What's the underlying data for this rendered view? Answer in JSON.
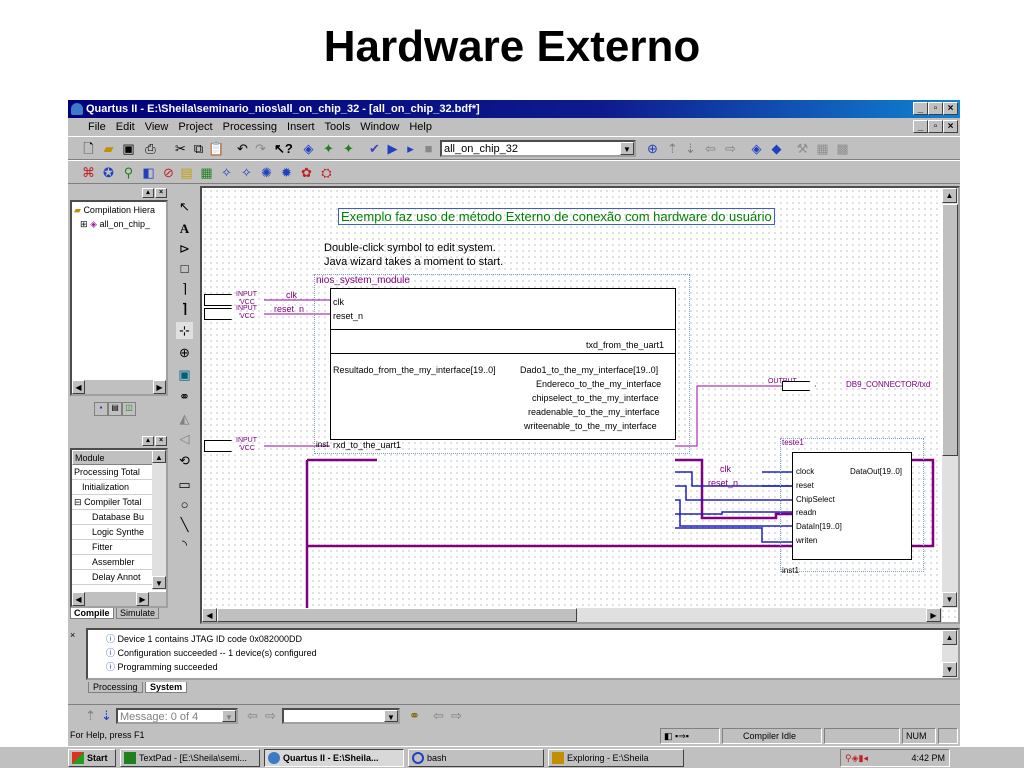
{
  "slide_title": "Hardware Externo",
  "window": {
    "title": "Quartus II - E:\\Sheila\\seminario_nios\\all_on_chip_32 - [all_on_chip_32.bdf*]",
    "menu": [
      "File",
      "Edit",
      "View",
      "Project",
      "Processing",
      "Insert",
      "Tools",
      "Window",
      "Help"
    ],
    "project_combo": "all_on_chip_32"
  },
  "project_nav": {
    "tree_root": "Compilation Hiera",
    "tree_child": "all_on_chip_",
    "tabs": [
      "Compile",
      "Simulate"
    ],
    "module_header": "Module",
    "modules": [
      "Processing Total",
      "Initialization",
      "Compiler Total",
      "Database Bu",
      "Logic Synthe",
      "Fitter",
      "Assembler",
      "Delay Annot"
    ]
  },
  "schematic": {
    "annotation": "Exemplo faz uso de método Externo de conexão com hardware do usuário",
    "hint_line1": "Double-click symbol to edit system.",
    "hint_line2": "Java wizard takes a moment to start.",
    "nios": {
      "name": "nios_system_module",
      "inst": "inst",
      "ports_left": [
        "clk",
        "reset_n",
        "rxd_to_the_uart1",
        "Resultado_from_the_my_interface[19..0]"
      ],
      "ports_right": [
        "txd_from_the_uart1",
        "Dado1_to_the_my_interface[19..0]",
        "Endereco_to_the_my_interface",
        "chipselect_to_the_my_interface",
        "readenable_to_the_my_interface",
        "writeenable_to_the_my_interface"
      ]
    },
    "inputs": [
      {
        "type": "INPUT",
        "vcc": "VCC",
        "net": "clk"
      },
      {
        "type": "INPUT",
        "vcc": "VCC",
        "net": "reset_n"
      },
      {
        "type": "INPUT",
        "vcc": "VCC",
        "net": ""
      }
    ],
    "output": {
      "type": "OUTPUT",
      "net": "DB9_CONNECTOR/txd"
    },
    "teste": {
      "name": "teste1",
      "inst": "inst1",
      "ports_left": [
        "clock",
        "reset",
        "ChipSelect",
        "readn",
        "DataIn[19..0]",
        "writen"
      ],
      "port_right": "DataOut[19..0]",
      "nets": [
        "clk",
        "reset_n"
      ]
    }
  },
  "messages": {
    "lines": [
      "Device 1 contains JTAG ID code 0x082000DD",
      "Configuration succeeded -- 1 device(s) configured",
      "Programming succeeded"
    ],
    "tabs": [
      "Processing",
      "System"
    ],
    "message_field": "Message: 0 of 4"
  },
  "statusbar": {
    "help": "For Help, press F1",
    "state": "Compiler Idle",
    "num": "NUM"
  },
  "taskbar": {
    "start": "Start",
    "items": [
      "TextPad - [E:\\Sheila\\semi...",
      "Quartus II - E:\\Sheila...",
      "bash",
      "Exploring - E:\\Sheila"
    ],
    "clock": "4:42 PM"
  },
  "colors": {
    "title_bar": "#00007b",
    "bus_wire": "#800080",
    "net_wire": "#2020c0",
    "annotation_text": "#008000"
  }
}
